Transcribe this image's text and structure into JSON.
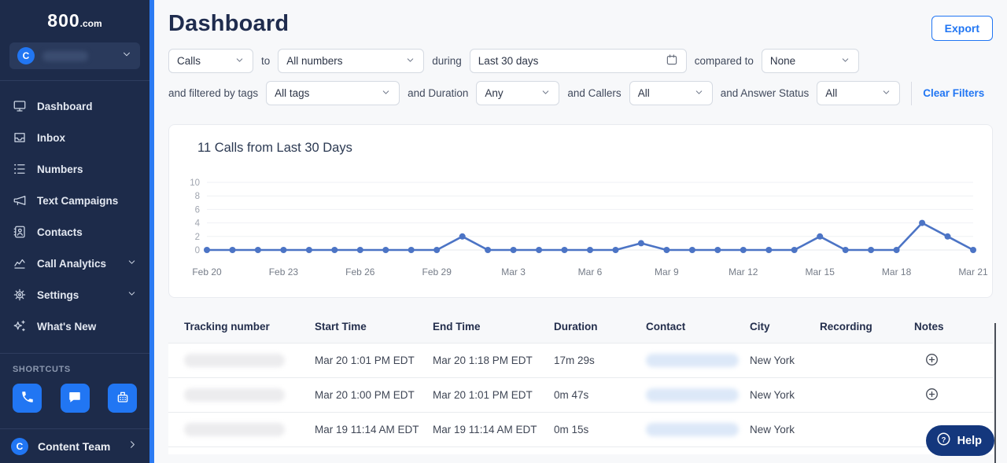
{
  "sidebar": {
    "logo_800": "800",
    "logo_com": ".com",
    "account_initial": "C",
    "nav": [
      {
        "label": "Dashboard"
      },
      {
        "label": "Inbox"
      },
      {
        "label": "Numbers"
      },
      {
        "label": "Text Campaigns"
      },
      {
        "label": "Contacts"
      },
      {
        "label": "Call Analytics"
      },
      {
        "label": "Settings"
      },
      {
        "label": "What's New"
      }
    ],
    "shortcuts_label": "SHORTCUTS",
    "footer_initial": "C",
    "footer_label": "Content Team"
  },
  "header": {
    "title": "Dashboard",
    "export_label": "Export"
  },
  "filters": {
    "type_value": "Calls",
    "to_label": "to",
    "numbers_value": "All numbers",
    "during_label": "during",
    "date_value": "Last 30 days",
    "compared_label": "compared to",
    "compared_value": "None",
    "tags_label": "and filtered by tags",
    "tags_value": "All tags",
    "duration_label": "and Duration",
    "duration_value": "Any",
    "callers_label": "and Callers",
    "callers_value": "All",
    "answer_label": "and Answer Status",
    "answer_value": "All",
    "clear_label": "Clear Filters"
  },
  "chart_data": {
    "type": "line",
    "title": "11 Calls from Last 30 Days",
    "x": [
      "Feb 20",
      "Feb 21",
      "Feb 22",
      "Feb 23",
      "Feb 24",
      "Feb 25",
      "Feb 26",
      "Feb 27",
      "Feb 28",
      "Feb 29",
      "Mar 1",
      "Mar 2",
      "Mar 3",
      "Mar 4",
      "Mar 5",
      "Mar 6",
      "Mar 7",
      "Mar 8",
      "Mar 9",
      "Mar 10",
      "Mar 11",
      "Mar 12",
      "Mar 13",
      "Mar 14",
      "Mar 15",
      "Mar 16",
      "Mar 17",
      "Mar 18",
      "Mar 19",
      "Mar 20",
      "Mar 21"
    ],
    "values": [
      0,
      0,
      0,
      0,
      0,
      0,
      0,
      0,
      0,
      0,
      2,
      0,
      0,
      0,
      0,
      0,
      0,
      1,
      0,
      0,
      0,
      0,
      0,
      0,
      2,
      0,
      0,
      0,
      4,
      2,
      0
    ],
    "tick_labels": [
      "Feb 20",
      "Feb 23",
      "Feb 26",
      "Feb 29",
      "Mar 3",
      "Mar 6",
      "Mar 9",
      "Mar 12",
      "Mar 15",
      "Mar 18",
      "Mar 21"
    ],
    "tick_every": 3,
    "yticks": [
      10,
      8,
      6,
      4,
      2,
      0
    ],
    "ylim": [
      0,
      10
    ],
    "grid": true,
    "legend_position": "none",
    "line_color": "#4c74c5"
  },
  "table": {
    "columns": [
      "Tracking number",
      "Start Time",
      "End Time",
      "Duration",
      "Contact",
      "City",
      "Recording",
      "Notes"
    ],
    "rows": [
      {
        "start": "Mar 20 1:01 PM EDT",
        "end": "Mar 20 1:18 PM EDT",
        "duration": "17m 29s",
        "city": "New York",
        "has_note_icon": true
      },
      {
        "start": "Mar 20 1:00 PM EDT",
        "end": "Mar 20 1:01 PM EDT",
        "duration": "0m 47s",
        "city": "New York",
        "has_note_icon": true
      },
      {
        "start": "Mar 19 11:14 AM EDT",
        "end": "Mar 19 11:14 AM EDT",
        "duration": "0m 15s",
        "city": "New York",
        "has_note_icon": false
      }
    ]
  },
  "help_label": "Help",
  "colors": {
    "sidebar_bg": "#1d2b4a",
    "accent_blue": "#2176f3",
    "scroll_strip_blue": "#2b7bf3",
    "chart_line": "#4c74c5",
    "help_bg": "#14377d",
    "page_bg": "#f7f8fa",
    "title_navy": "#1f2c4e"
  }
}
